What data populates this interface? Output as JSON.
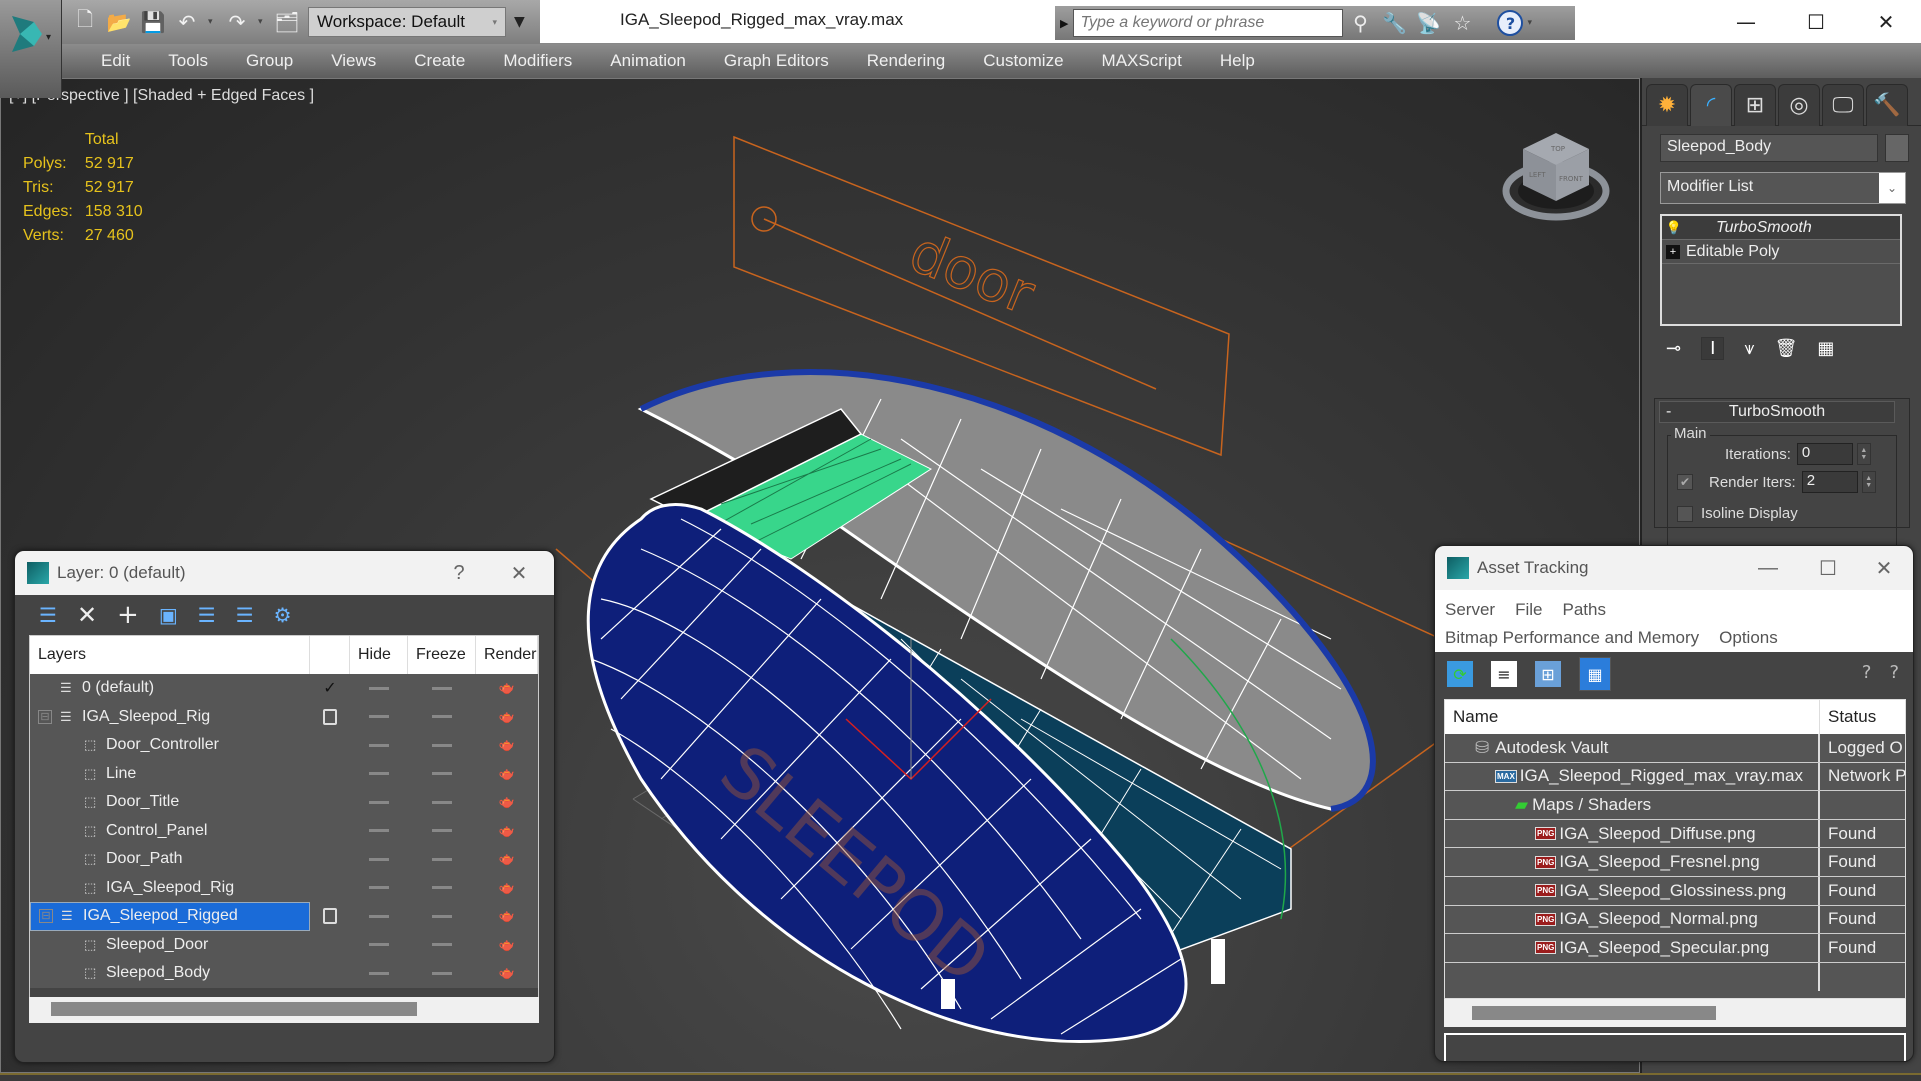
{
  "titlebar": {
    "document_title": "IGA_Sleepod_Rigged_max_vray.max",
    "workspace_label": "Workspace: Default",
    "search_placeholder": "Type a keyword or phrase",
    "window_controls": {
      "minimize": "—",
      "maximize": "☐",
      "close": "✕"
    }
  },
  "menubar": [
    "Edit",
    "Tools",
    "Group",
    "Views",
    "Create",
    "Modifiers",
    "Animation",
    "Graph Editors",
    "Rendering",
    "Customize",
    "MAXScript",
    "Help"
  ],
  "viewport": {
    "label": "[+] [Perspective ] [Shaded + Edged Faces ]",
    "stats": {
      "header": "Total",
      "rows": [
        {
          "label": "Polys:",
          "value": "52 917"
        },
        {
          "label": "Tris:",
          "value": "52 917"
        },
        {
          "label": "Edges:",
          "value": "158 310"
        },
        {
          "label": "Verts:",
          "value": "27 460"
        }
      ]
    },
    "scene_text": "door",
    "model_text": "SLEEPOD",
    "viewcube": {
      "top": "TOP",
      "left": "LEFT",
      "front": "FRONT"
    },
    "colors": {
      "helper_orange": "#c8641e",
      "mesh_blue": "#0e1f7a",
      "wire_white": "#ffffff",
      "selection_green": "#38d68b",
      "stats_yellow": "#e6c21c"
    }
  },
  "command_panel": {
    "tabs": [
      "create",
      "modify",
      "hierarchy",
      "motion",
      "display",
      "utilities"
    ],
    "active_tab": "modify",
    "object_name": "Sleepod_Body",
    "modifier_list_label": "Modifier List",
    "modifier_stack": [
      {
        "name": "TurboSmooth",
        "icon": "lightbulb-icon",
        "selected": true
      },
      {
        "name": "Editable Poly",
        "icon": "plus-icon",
        "selected": false
      }
    ],
    "turbosmooth": {
      "title": "TurboSmooth",
      "collapse": "-",
      "group_label": "Main",
      "iterations_label": "Iterations:",
      "iterations_value": "0",
      "render_iters_label": "Render Iters:",
      "render_iters_value": "2",
      "render_iters_checked": true,
      "isoline_label": "Isoline Display",
      "isoline_checked": false
    }
  },
  "layer_window": {
    "title": "Layer: 0 (default)",
    "help": "?",
    "close": "✕",
    "columns": [
      "Layers",
      "",
      "Hide",
      "Freeze",
      "Render"
    ],
    "rows": [
      {
        "name": "0 (default)",
        "type": "layer",
        "level": 0,
        "expander": "",
        "current": "✓",
        "selected": false
      },
      {
        "name": "IGA_Sleepod_Rig",
        "type": "layer",
        "level": 0,
        "expander": "⊟",
        "current": "box",
        "selected": false
      },
      {
        "name": "Door_Controller",
        "type": "object",
        "level": 1,
        "expander": "",
        "current": "",
        "selected": false
      },
      {
        "name": "Line",
        "type": "object",
        "level": 1,
        "expander": "",
        "current": "",
        "selected": false
      },
      {
        "name": "Door_Title",
        "type": "object",
        "level": 1,
        "expander": "",
        "current": "",
        "selected": false
      },
      {
        "name": "Control_Panel",
        "type": "object",
        "level": 1,
        "expander": "",
        "current": "",
        "selected": false
      },
      {
        "name": "Door_Path",
        "type": "object",
        "level": 1,
        "expander": "",
        "current": "",
        "selected": false
      },
      {
        "name": "IGA_Sleepod_Rig",
        "type": "object",
        "level": 1,
        "expander": "",
        "current": "",
        "selected": false
      },
      {
        "name": "IGA_Sleepod_Rigged",
        "type": "layer",
        "level": 0,
        "expander": "⊟",
        "current": "box",
        "selected": true
      },
      {
        "name": "Sleepod_Door",
        "type": "object",
        "level": 1,
        "expander": "",
        "current": "",
        "selected": false
      },
      {
        "name": "Sleepod_Body",
        "type": "object",
        "level": 1,
        "expander": "",
        "current": "",
        "selected": false
      }
    ]
  },
  "asset_window": {
    "title": "Asset Tracking",
    "menu_row1": [
      "Server",
      "File",
      "Paths"
    ],
    "menu_row2": [
      "Bitmap Performance and Memory",
      "Options"
    ],
    "columns": [
      "Name",
      "Status"
    ],
    "rows": [
      {
        "name": "Autodesk Vault",
        "status": "Logged O",
        "icon": "vault-icon",
        "level": 1
      },
      {
        "name": "IGA_Sleepod_Rigged_max_vray.max",
        "status": "Network P",
        "icon": "max-file-icon",
        "level": 2
      },
      {
        "name": "Maps / Shaders",
        "status": "",
        "icon": "maps-icon",
        "level": 3
      },
      {
        "name": "IGA_Sleepod_Diffuse.png",
        "status": "Found",
        "icon": "png-icon",
        "level": 4
      },
      {
        "name": "IGA_Sleepod_Fresnel.png",
        "status": "Found",
        "icon": "png-icon",
        "level": 4
      },
      {
        "name": "IGA_Sleepod_Glossiness.png",
        "status": "Found",
        "icon": "png-icon",
        "level": 4
      },
      {
        "name": "IGA_Sleepod_Normal.png",
        "status": "Found",
        "icon": "png-icon",
        "level": 4
      },
      {
        "name": "IGA_Sleepod_Specular.png",
        "status": "Found",
        "icon": "png-icon",
        "level": 4
      }
    ],
    "png_badge": "PNG",
    "max_badge": "MAX"
  }
}
